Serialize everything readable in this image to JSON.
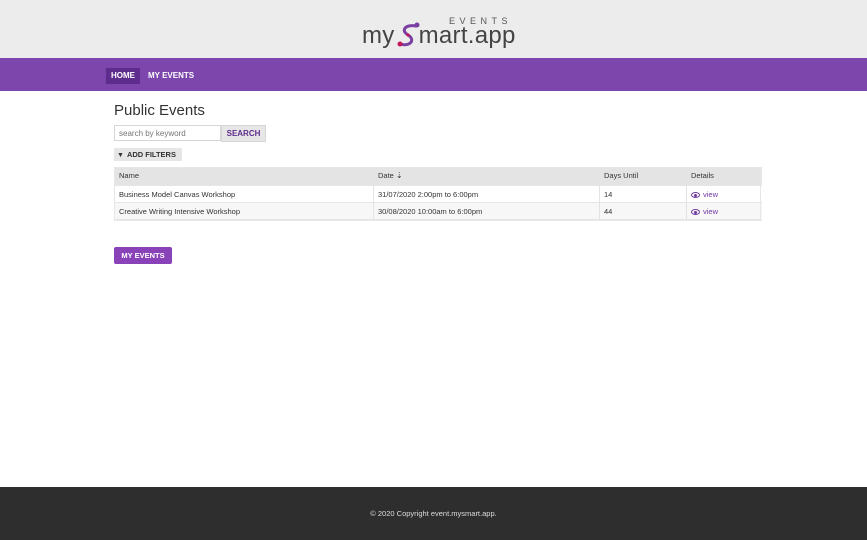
{
  "logo": {
    "events": "EVENTS",
    "part1": "my",
    "part2": "mart.app"
  },
  "nav": {
    "home": "HOME",
    "my_events": "MY EVENTS"
  },
  "page": {
    "title": "Public Events"
  },
  "search": {
    "placeholder": "search by keyword",
    "button": "SEARCH"
  },
  "filters": {
    "label": "ADD FILTERS",
    "icon": "filter-icon"
  },
  "table": {
    "headers": [
      "Name",
      "Date",
      "Days Until",
      "Details"
    ],
    "rows": [
      {
        "name": "Business Model Canvas Workshop",
        "date": "31/07/2020 2:00pm to 6:00pm",
        "days": "14",
        "details": "view"
      },
      {
        "name": "Creative Writing Intensive Workshop",
        "date": "30/08/2020 10:00am to 6:00pm",
        "days": "44",
        "details": "view"
      }
    ]
  },
  "buttons": {
    "my_events": "MY EVENTS"
  },
  "footer": {
    "text": "© 2020 Copyright event.mysmart.app."
  },
  "colors": {
    "nav": "#7d46ad",
    "nav_active": "#5e2c8d",
    "accent": "#8a42b8",
    "footer": "#2e2e2e",
    "header": "#ececec"
  }
}
